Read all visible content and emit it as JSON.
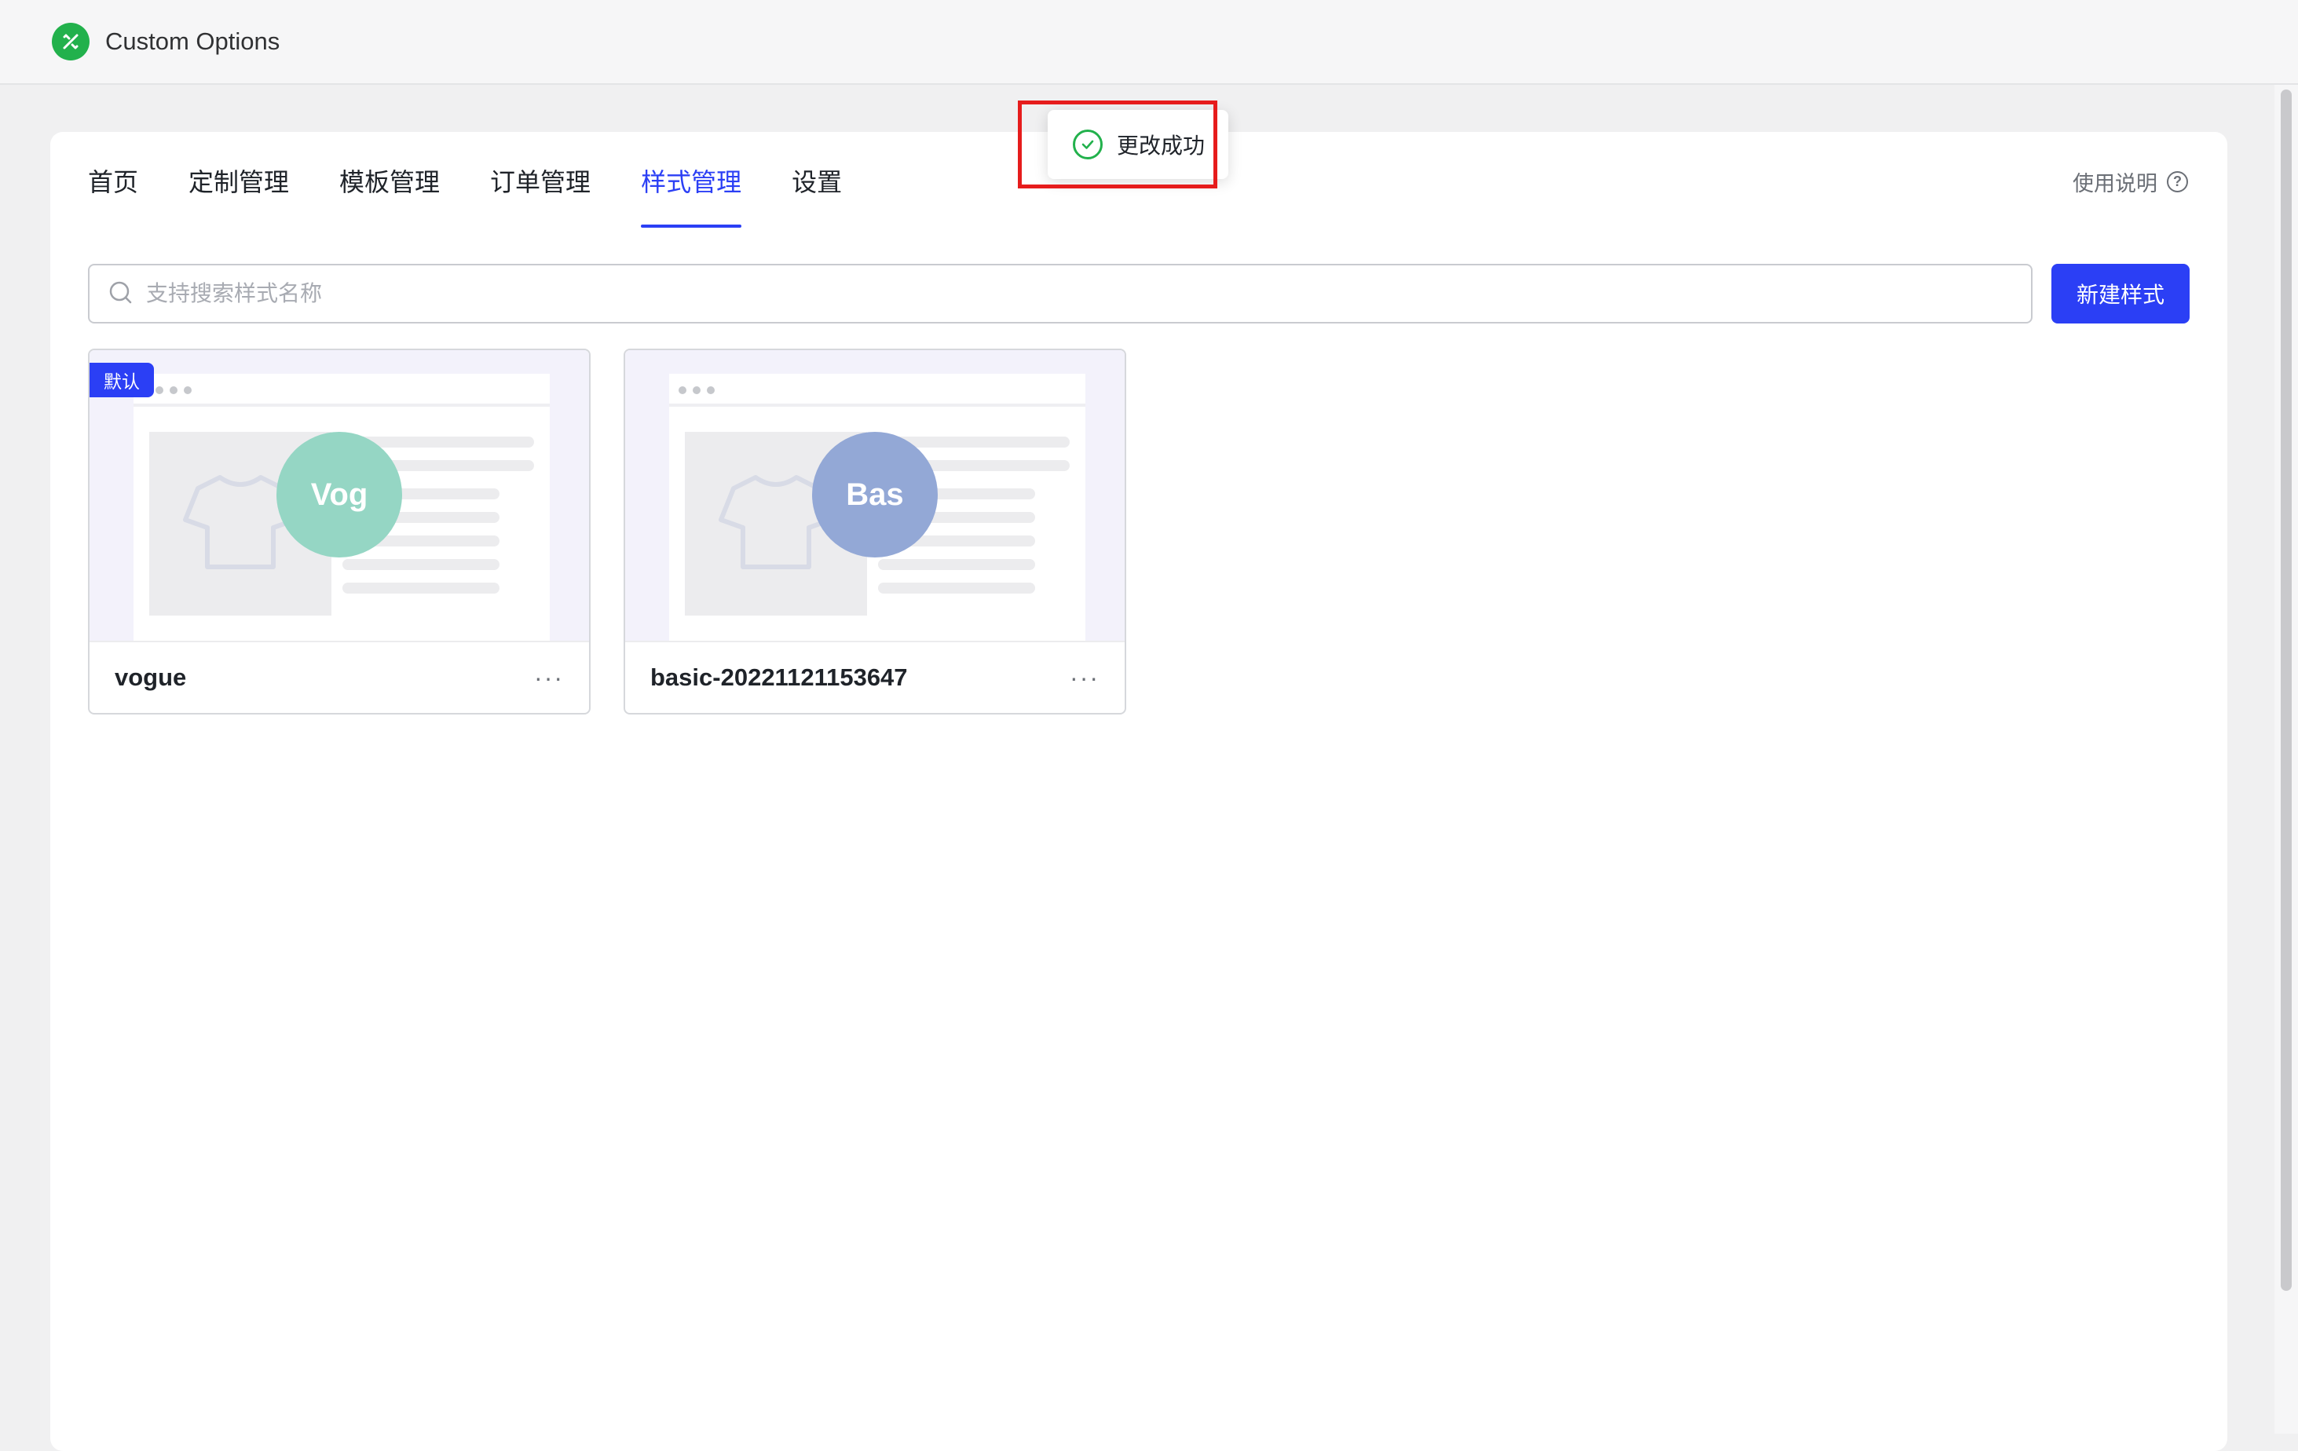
{
  "app": {
    "title": "Custom Options",
    "logo_icon": "tools-icon",
    "brand_color": "#22b14c"
  },
  "nav": {
    "tabs": [
      {
        "label": "首页"
      },
      {
        "label": "定制管理"
      },
      {
        "label": "模板管理"
      },
      {
        "label": "订单管理"
      },
      {
        "label": "样式管理",
        "active": true
      },
      {
        "label": "设置"
      }
    ],
    "help_label": "使用说明",
    "help_icon": "?"
  },
  "search": {
    "placeholder": "支持搜索样式名称",
    "value": ""
  },
  "new_style_button": "新建样式",
  "accent_color": "#2b3ff5",
  "styles": [
    {
      "name": "vogue",
      "avatar": "Vog",
      "avatar_color": "#95d6c4",
      "default_badge": "默认",
      "more": "···"
    },
    {
      "name": "basic-20221121153647",
      "avatar": "Bas",
      "avatar_color": "#93a8d6",
      "more": "···"
    }
  ],
  "toast": {
    "message": "更改成功",
    "icon": "check-circle-icon",
    "color": "#22b14c"
  }
}
